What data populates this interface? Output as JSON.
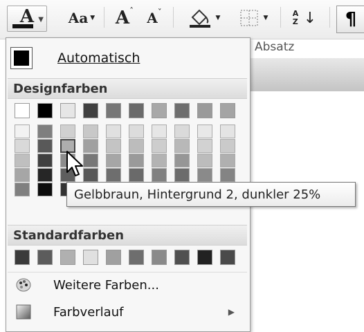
{
  "toolbar": {
    "font_color_glyph": "A",
    "change_case": "Aa",
    "grow_font": "A",
    "shrink_font": "A",
    "sort": "A Z",
    "pilcrow": "¶",
    "section_label": "Absatz"
  },
  "menu": {
    "automatic_label": "Automatisch",
    "theme_colors_header": "Designfarben",
    "theme_colors": [
      "#ffffff",
      "#000000",
      "#e6e6e6",
      "#404040",
      "#777777",
      "#6a6a6a",
      "#a8a8a8",
      "#6e6e6e",
      "#9a9a9a",
      "#a4a4a4"
    ],
    "theme_shades": [
      [
        "#f2f2f2",
        "#d9d9d9",
        "#bfbfbf",
        "#a6a6a6",
        "#808080"
      ],
      [
        "#7f7f7f",
        "#595959",
        "#404040",
        "#262626",
        "#0d0d0d"
      ],
      [
        "#d0d0d0",
        "#aeaeae",
        "#8c8c8c",
        "#5e5e5e",
        "#323232"
      ],
      [
        "#c8c8c8",
        "#a0a0a0",
        "#787878",
        "#585858",
        "#383838"
      ],
      [
        "#e0e0e0",
        "#c4c4c4",
        "#a6a6a6",
        "#6e6e6e",
        "#4a4a4a"
      ],
      [
        "#dcdcdc",
        "#bcbcbc",
        "#9a9a9a",
        "#6a6a6a",
        "#464646"
      ],
      [
        "#e6e6e6",
        "#cdcdcd",
        "#b3b3b3",
        "#808080",
        "#555555"
      ],
      [
        "#dadada",
        "#b8b8b8",
        "#969696",
        "#6c6c6c",
        "#484848"
      ],
      [
        "#e8e8e8",
        "#d2d2d2",
        "#bcbcbc",
        "#8a8a8a",
        "#5c5c5c"
      ],
      [
        "#e4e4e4",
        "#cacaca",
        "#b0b0b0",
        "#848484",
        "#585858"
      ]
    ],
    "standard_colors_header": "Standardfarben",
    "standard_colors": [
      "#3a3a3a",
      "#5c5c5c",
      "#b0b0b0",
      "#e0e0e0",
      "#a0a0a0",
      "#6e6e6e",
      "#8a8a8a",
      "#505050",
      "#222222",
      "#4a4a4a"
    ],
    "more_colors_label": "Weitere Farben...",
    "gradient_label": "Farbverlauf"
  },
  "tooltip": {
    "text": "Gelbbraun, Hintergrund 2, dunkler 25%"
  }
}
